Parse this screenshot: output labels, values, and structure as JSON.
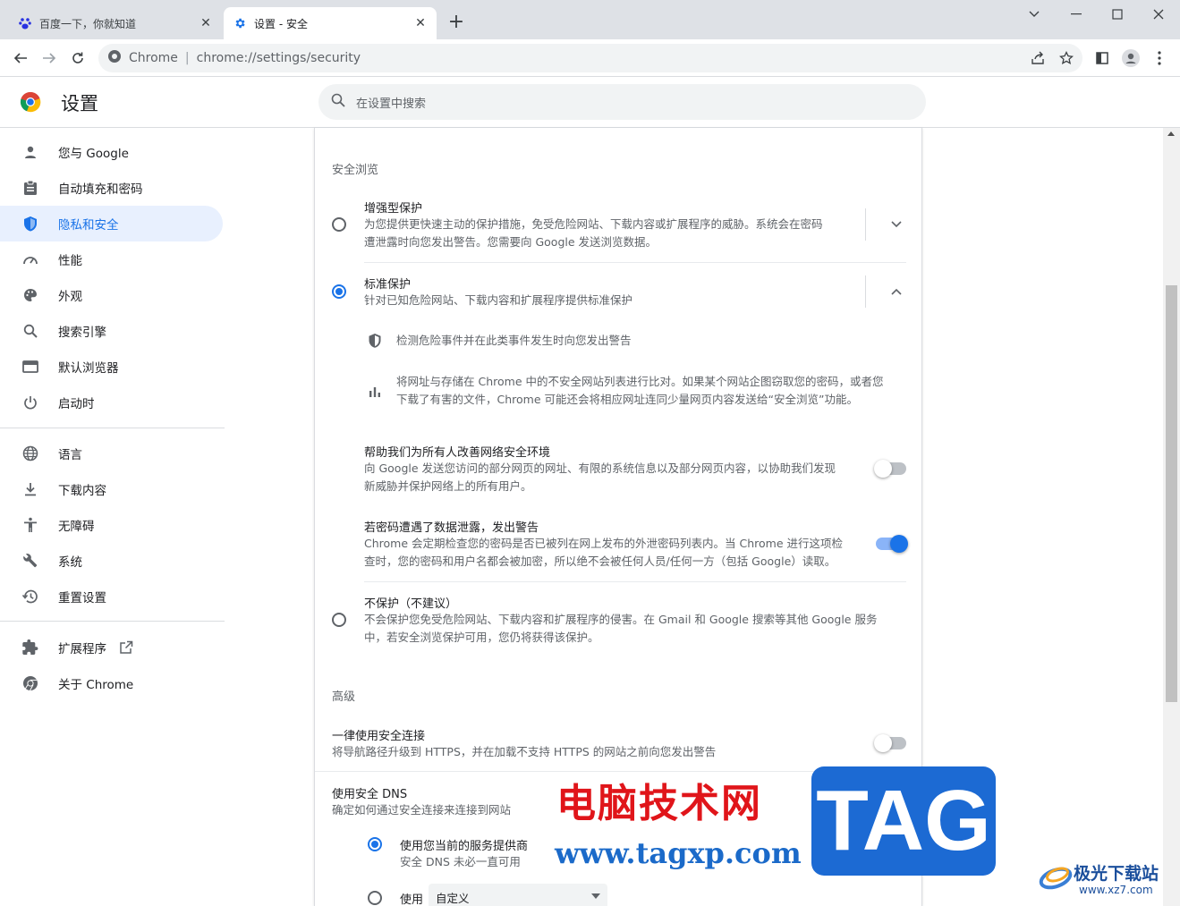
{
  "browser": {
    "tabs": [
      {
        "title": "百度一下，你就知道",
        "active": false,
        "icon": "baidu-paw-icon"
      },
      {
        "title": "设置 - 安全",
        "active": true,
        "icon": "gear-icon"
      }
    ],
    "new_tab": "+",
    "address": {
      "site": "Chrome",
      "url": "chrome://settings/security"
    }
  },
  "header": {
    "title": "设置",
    "search_placeholder": "在设置中搜索"
  },
  "sidebar": {
    "items": [
      {
        "label": "您与 Google",
        "icon": "person-icon"
      },
      {
        "label": "自动填充和密码",
        "icon": "clipboard-icon"
      },
      {
        "label": "隐私和安全",
        "icon": "shield-icon",
        "selected": true
      },
      {
        "label": "性能",
        "icon": "speedometer-icon"
      },
      {
        "label": "外观",
        "icon": "palette-icon"
      },
      {
        "label": "搜索引擎",
        "icon": "search-icon"
      },
      {
        "label": "默认浏览器",
        "icon": "browser-window-icon"
      },
      {
        "label": "启动时",
        "icon": "power-icon"
      }
    ],
    "items2": [
      {
        "label": "语言",
        "icon": "globe-icon"
      },
      {
        "label": "下载内容",
        "icon": "download-icon"
      },
      {
        "label": "无障碍",
        "icon": "accessibility-icon"
      },
      {
        "label": "系统",
        "icon": "wrench-icon"
      },
      {
        "label": "重置设置",
        "icon": "reset-history-icon"
      }
    ],
    "items3": [
      {
        "label": "扩展程序",
        "icon": "puzzle-icon"
      },
      {
        "label": "关于 Chrome",
        "icon": "chrome-icon"
      }
    ]
  },
  "security": {
    "section_safe_browsing": "安全浏览",
    "enhanced": {
      "title": "增强型保护",
      "desc_line1": "为您提供更快速主动的保护措施，免受危险网站、下载内容或扩展程序的威胁。系统会在密码",
      "desc_line2": "遭泄露时向您发出警告。您需要向 Google 发送浏览数据。",
      "selected": false
    },
    "standard": {
      "title": "标准保护",
      "desc": "针对已知危险网站、下载内容和扩展程序提供标准保护",
      "selected": true,
      "feature1": "检测危险事件并在此类事件发生时向您发出警告",
      "feature2_line1": "将网址与存储在 Chrome 中的不安全网站列表进行比对。如果某个网站企图窃取您的密码，或者您",
      "feature2_line2": "下载了有害的文件，Chrome 可能还会将相应网址连同少量网页内容发送给“安全浏览”功能。"
    },
    "help_improve": {
      "title": "帮助我们为所有人改善网络安全环境",
      "desc_line1": "向 Google 发送您访问的部分网页的网址、有限的系统信息以及部分网页内容，以协助我们发现",
      "desc_line2": "新威胁并保护网络上的所有用户。",
      "enabled": false
    },
    "password_leak": {
      "title": "若密码遭遇了数据泄露，发出警告",
      "desc_line1": "Chrome 会定期检查您的密码是否已被列在网上发布的外泄密码列表内。当 Chrome 进行这项检",
      "desc_line2": "查时，您的密码和用户名都会被加密，所以绝不会被任何人员/任何一方（包括 Google）读取。",
      "enabled": true
    },
    "no_protection": {
      "title": "不保护（不建议）",
      "desc_line1": "不会保护您免受危险网站、下载内容和扩展程序的侵害。在 Gmail 和 Google 搜索等其他 Google 服务",
      "desc_line2": "中，若安全浏览保护可用，您仍将获得该保护。",
      "selected": false
    },
    "section_advanced": "高级",
    "https_only": {
      "title": "一律使用安全连接",
      "desc": "将导航路径升级到 HTTPS，并在加载不支持 HTTPS 的网站之前向您发出警告",
      "enabled": false
    },
    "secure_dns": {
      "title": "使用安全 DNS",
      "desc": "确定如何通过安全连接来连接到网站",
      "option_current": "使用您当前的服务提供商",
      "option_current_desc": "安全 DNS 未必一直可用",
      "option_custom": "使用",
      "custom_value": "自定义"
    }
  },
  "watermark": {
    "cn_text": "电脑技术网",
    "url": "www.tagxp.com",
    "tag": "TAG",
    "site_cn": "极光下载站",
    "site_url": "www.xz7.com"
  },
  "colors": {
    "accent": "#1a73e8",
    "selected_bg": "#e8f0fe",
    "watermark_red": "#e0151a",
    "watermark_blue": "#1c6ad3"
  }
}
